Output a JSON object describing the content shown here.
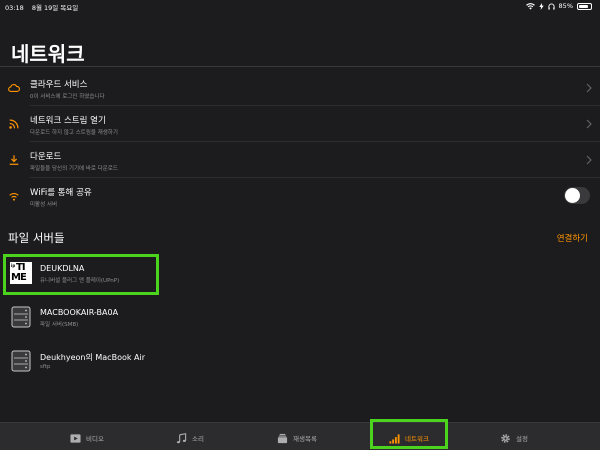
{
  "status_bar": {
    "time": "03:18",
    "date": "8월 19일 목요일",
    "battery": "85%",
    "battery_level": 0.85
  },
  "page": {
    "title": "네트워크"
  },
  "network_rows": [
    {
      "icon": "cloud-icon",
      "title": "클라우드 서비스",
      "subtitle": "0이 서비스에 로그인 하였습니다"
    },
    {
      "icon": "rss-stream-icon",
      "title": "네트워크 스트림 열기",
      "subtitle": "다운로드 하지 않고 스트림을 재생하기"
    },
    {
      "icon": "download-icon",
      "title": "다운로드",
      "subtitle": "파일들을 당신의 기기에 바로 다운로드"
    },
    {
      "icon": "wifi-icon",
      "title": "WiFi를 통해 공유",
      "subtitle": "미활성 서버",
      "toggle_on": false
    }
  ],
  "file_servers": {
    "section_title": "파일 서버들",
    "connect_label": "연결하기",
    "items": [
      {
        "icon": "iptime-logo-icon",
        "logo_text": [
          "ip",
          "TI",
          "ME"
        ],
        "name": "DEUKDLNA",
        "type": "유니버셜 플러그 앤 플레이(UPnP)"
      },
      {
        "icon": "server-icon",
        "name": "MACBOOKAIR-BA0A",
        "type": "파일 서버(SMB)"
      },
      {
        "icon": "server-icon",
        "name": "Deukhyeon의 MacBook Air",
        "type": "sftp"
      }
    ]
  },
  "tabbar": {
    "tabs": [
      {
        "icon": "video-icon",
        "label": "비디오",
        "active": false
      },
      {
        "icon": "music-note-icon",
        "label": "소리",
        "active": false
      },
      {
        "icon": "playlist-icon",
        "label": "재생목록",
        "active": false
      },
      {
        "icon": "network-bars-icon",
        "label": "네트워크",
        "active": true
      },
      {
        "icon": "gear-icon",
        "label": "설정",
        "active": false
      }
    ]
  },
  "colors": {
    "background": "#1c1c1e",
    "accent": "#ff9500",
    "highlight": "#4cd31d",
    "subtext": "#8e8e93",
    "tabbar": "#2c2c2e"
  }
}
